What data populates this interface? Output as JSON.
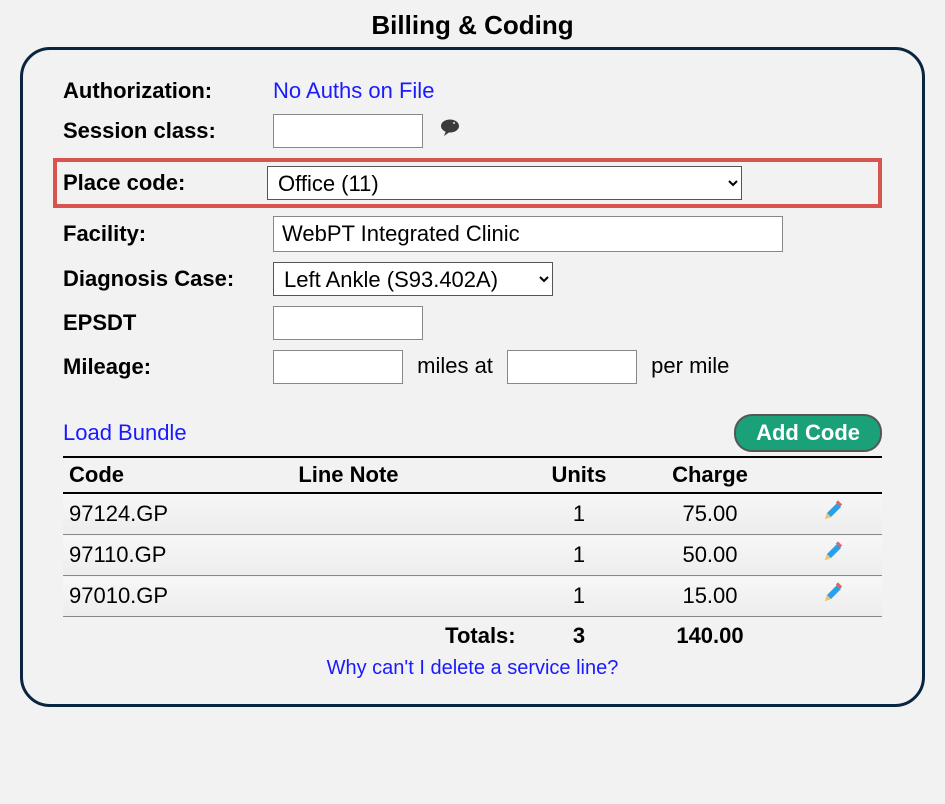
{
  "title": "Billing & Coding",
  "labels": {
    "authorization": "Authorization:",
    "session_class": "Session class:",
    "place_code": "Place code:",
    "facility": "Facility:",
    "diagnosis_case": "Diagnosis Case:",
    "epsdt": "EPSDT",
    "mileage": "Mileage:",
    "miles_at": "miles at",
    "per_mile": "per mile"
  },
  "values": {
    "authorization": "No Auths on File",
    "session_class": "",
    "place_code": "Office (11)",
    "facility": "WebPT Integrated Clinic",
    "diagnosis_case": "Left Ankle (S93.402A)",
    "epsdt": "",
    "miles": "",
    "rate": ""
  },
  "actions": {
    "load_bundle": "Load Bundle",
    "add_code": "Add Code"
  },
  "table": {
    "headers": {
      "code": "Code",
      "line_note": "Line Note",
      "units": "Units",
      "charge": "Charge"
    },
    "rows": [
      {
        "code": "97124.GP",
        "line_note": "",
        "units": "1",
        "charge": "75.00"
      },
      {
        "code": "97110.GP",
        "line_note": "",
        "units": "1",
        "charge": "50.00"
      },
      {
        "code": "97010.GP",
        "line_note": "",
        "units": "1",
        "charge": "15.00"
      }
    ],
    "totals": {
      "label": "Totals:",
      "units": "3",
      "charge": "140.00"
    }
  },
  "help_link": "Why can't I delete a service line?"
}
